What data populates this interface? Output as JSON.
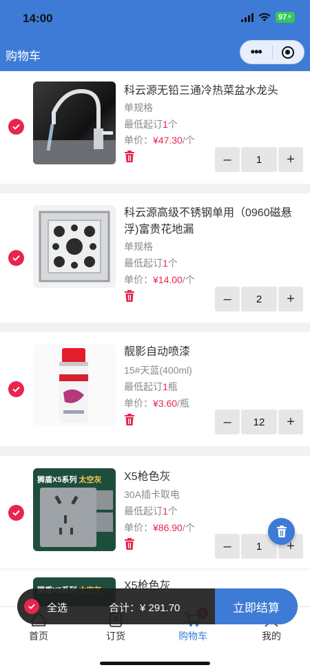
{
  "status_bar": {
    "time": "14:00",
    "battery": "97"
  },
  "nav": {
    "title": "购物车"
  },
  "items": [
    {
      "name": "科云源无铅三通冷热菜盆水龙头",
      "spec": "单规格",
      "min_prefix": "最低起订",
      "min_qty": "1",
      "min_unit": "个",
      "price_prefix": "单价：",
      "price": "¥47.30",
      "price_unit": "/个",
      "quantity": "1"
    },
    {
      "name": "科云源高级不锈钢单用（0960磁悬浮)富贵花地漏",
      "spec": "单规格",
      "min_prefix": "最低起订",
      "min_qty": "1",
      "min_unit": "个",
      "price_prefix": "单价：",
      "price": "¥14.00",
      "price_unit": "/个",
      "quantity": "2"
    },
    {
      "name": "靓影自动喷漆",
      "spec": "15#天蓝(400ml)",
      "min_prefix": "最低起订",
      "min_qty": "1",
      "min_unit": "瓶",
      "price_prefix": "单价：",
      "price": "¥3.60",
      "price_unit": "/瓶",
      "quantity": "12"
    },
    {
      "name": "X5枪色灰",
      "spec": "30A插卡取电",
      "min_prefix": "最低起订",
      "min_qty": "1",
      "min_unit": "个",
      "price_prefix": "单价：",
      "price": "¥86.90",
      "price_unit": "/个",
      "quantity": "1",
      "image_text": [
        "狮盾X5系列",
        "太空灰"
      ]
    },
    {
      "name": "X5枪色灰",
      "image_text": [
        "狮盾X5系列",
        "太空灰"
      ]
    }
  ],
  "stepper": {
    "minus": "–",
    "plus": "+"
  },
  "checkout": {
    "select_all": "全选",
    "total_label": "合计：",
    "total_value": "¥ 291.70",
    "pay_button": "立即结算"
  },
  "tabs": [
    {
      "label": "首页",
      "icon": "home-icon"
    },
    {
      "label": "订货",
      "icon": "order-icon"
    },
    {
      "label": "购物车",
      "icon": "cart-icon",
      "badge": "6",
      "active": true
    },
    {
      "label": "我的",
      "icon": "user-icon"
    }
  ],
  "colors": {
    "brand": "#3d7bd6",
    "accent": "#e8254b"
  }
}
